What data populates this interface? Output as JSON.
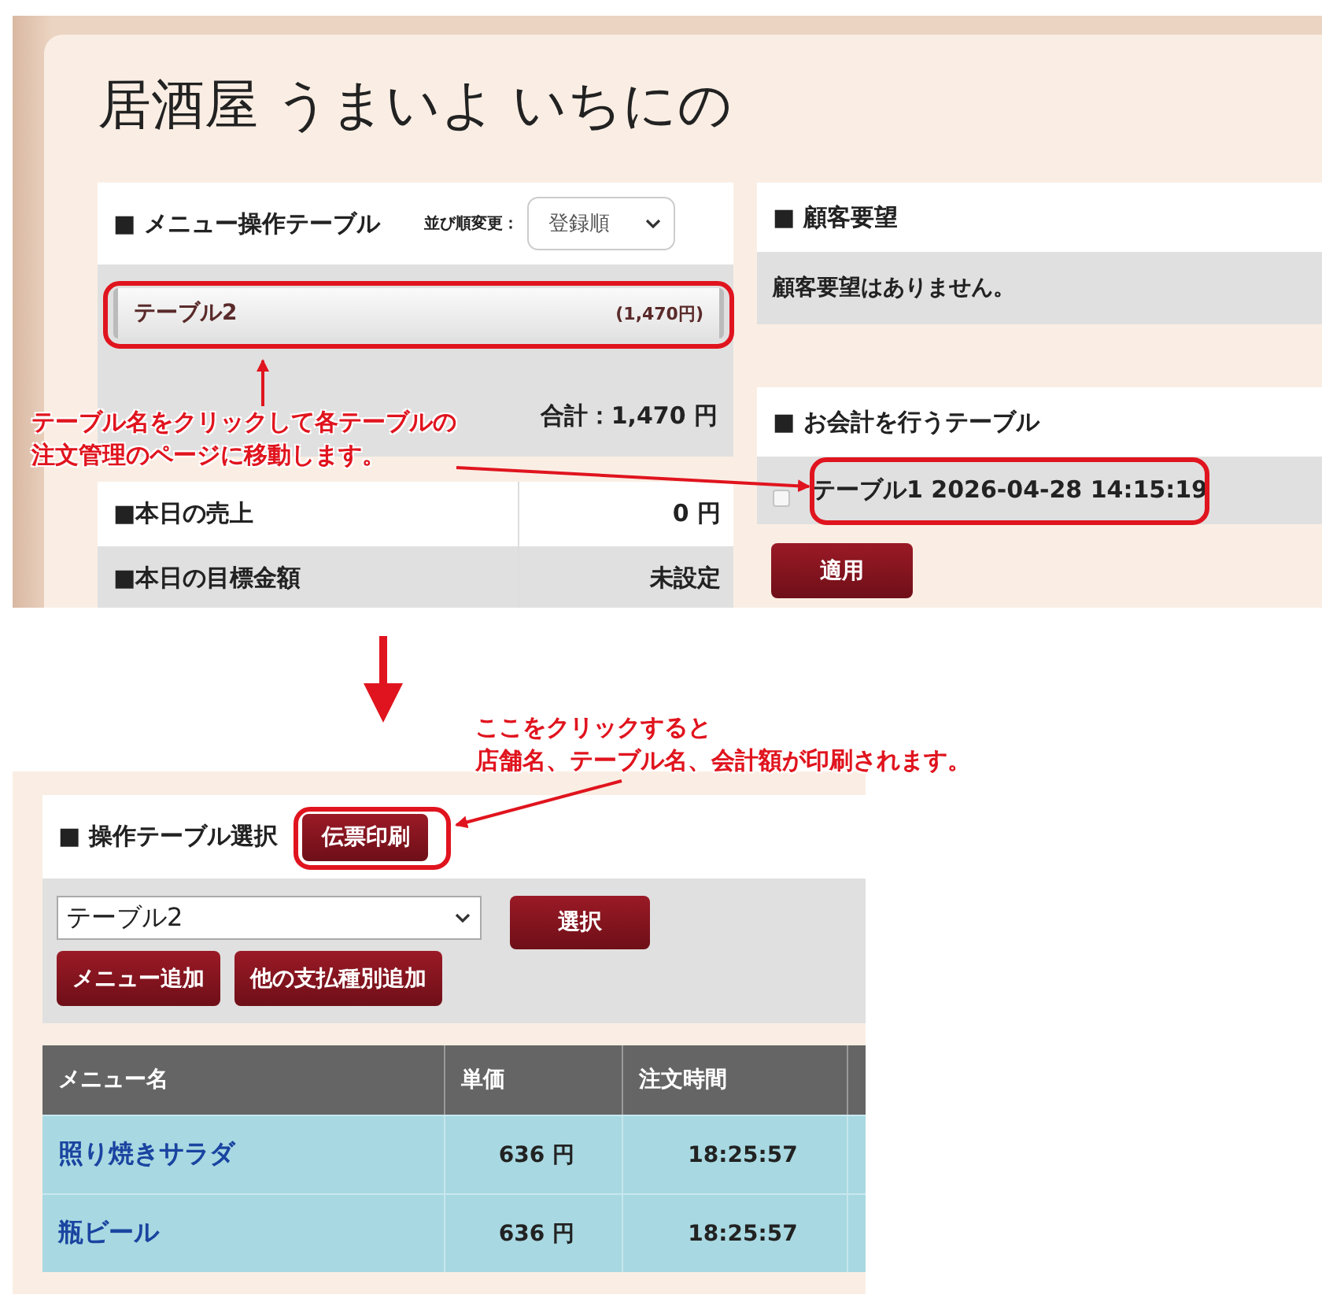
{
  "top_screen": {
    "title": "居酒屋 うまいよ いちにの",
    "menu_panel": {
      "heading": "■ メニュー操作テーブル",
      "sort_label": "並び順変更：",
      "sort_value": "登録順",
      "tables": [
        {
          "name": "テーブル2",
          "amount": "(1,470円)"
        }
      ],
      "total": "合計：1,470 円"
    },
    "stats": [
      {
        "label": "■本日の売上",
        "value": "0 円"
      },
      {
        "label": "■本日の目標金額",
        "value": "未設定"
      }
    ],
    "requests_panel": {
      "heading": "■ 顧客要望",
      "message": "顧客要望はありません。"
    },
    "checkout_panel": {
      "heading": "■ お会計を行うテーブル",
      "items": [
        {
          "label": "テーブル1 2026-04-28 14:15:19",
          "checked": false
        }
      ],
      "apply_button": "適用"
    }
  },
  "bottom_screen": {
    "heading": "■ 操作テーブル選択",
    "print_button": "伝票印刷",
    "table_select": "テーブル2",
    "select_button": "選択",
    "buttons": [
      "メニュー追加",
      "他の支払種別追加"
    ],
    "columns": [
      "メニュー名",
      "単価",
      "注文時間"
    ],
    "rows": [
      {
        "cells": [
          "照り焼きサラダ",
          "636 円",
          "18:25:57"
        ]
      },
      {
        "cells": [
          "瓶ビール",
          "636 円",
          "18:25:57"
        ]
      }
    ]
  },
  "annotations": [
    {
      "lines": [
        "テーブル名をクリックして各テーブルの",
        "注文管理のページに移動します。"
      ]
    },
    {
      "lines": [
        "ここをクリックすると",
        "店舗名、テーブル名、会計額が印刷されます。"
      ]
    }
  ]
}
